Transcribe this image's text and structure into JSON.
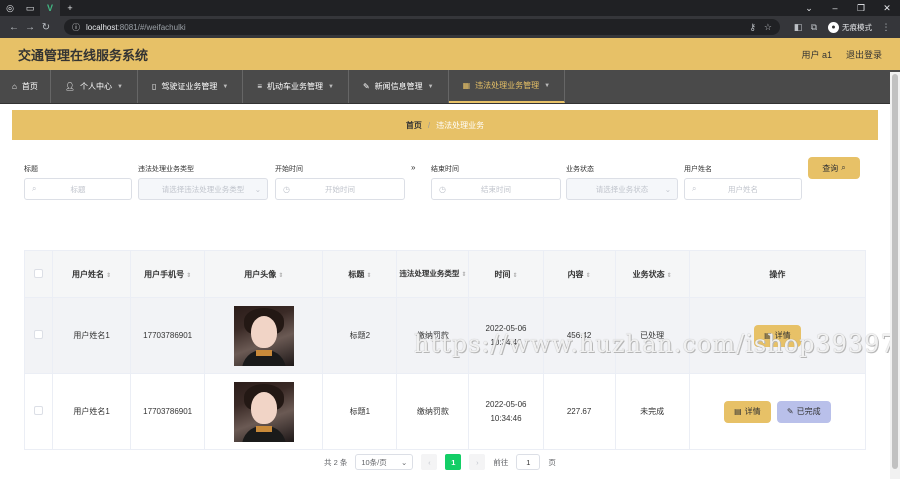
{
  "browser": {
    "url_host": "localhost",
    "url_path": ":8081/#/weifachulki",
    "incognito_label": "无痕模式"
  },
  "header": {
    "title": "交通管理在线服务系统",
    "user": "用户 a1",
    "logout": "退出登录"
  },
  "menu": [
    {
      "label": "首页",
      "icon": "home-icon"
    },
    {
      "label": "个人中心",
      "icon": "user-icon"
    },
    {
      "label": "驾驶证业务管理",
      "icon": "license-icon"
    },
    {
      "label": "机动车业务管理",
      "icon": "list-icon"
    },
    {
      "label": "新闻信息管理",
      "icon": "news-icon"
    },
    {
      "label": "违法处理业务管理",
      "icon": "grid-icon",
      "active": true
    }
  ],
  "breadcrumb": {
    "home": "首页",
    "separator": "/",
    "current": "违法处理业务"
  },
  "filters": {
    "title_label": "标题",
    "title_placeholder": "标题",
    "type_label": "违法处理业务类型",
    "type_placeholder": "请选择违法处理业务类型",
    "start_label": "开始时间",
    "start_placeholder": "开始时间",
    "arrow": "»",
    "end_label": "结束时间",
    "end_placeholder": "结束时间",
    "status_label": "业务状态",
    "status_placeholder": "请选择业务状态",
    "username_label": "用户姓名",
    "username_placeholder": "用户姓名",
    "search_button": "查询"
  },
  "table": {
    "headers": [
      "用户姓名",
      "用户手机号",
      "用户头像",
      "标题",
      "违法处理业务类型",
      "时间",
      "内容",
      "业务状态",
      "操作"
    ],
    "rows": [
      {
        "name": "用户姓名1",
        "phone": "17703786901",
        "title": "标题2",
        "type": "缴纳罚款",
        "time": "2022-05-06 10:34:46",
        "content": "456.42",
        "status": "已处理",
        "actions": [
          "详情"
        ]
      },
      {
        "name": "用户姓名1",
        "phone": "17703786901",
        "title": "标题1",
        "type": "缴纳罚款",
        "time": "2022-05-06 10:34:46",
        "content": "227.67",
        "status": "未完成",
        "actions": [
          "详情",
          "已完成"
        ]
      }
    ]
  },
  "pagination": {
    "total": "共 2 条",
    "page_size": "10条/页",
    "current_page": "1",
    "goto_label": "前往",
    "goto_value": "1",
    "page_suffix": "页"
  },
  "watermark": "https://www.huzhan.com/ishop39397",
  "colors": {
    "accent": "#e7c167",
    "menu_bg": "#4a4a4a",
    "page_active": "#13ce66",
    "secondary_button": "#b9c0ea"
  }
}
